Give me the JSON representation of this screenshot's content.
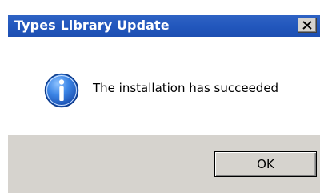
{
  "window": {
    "title": "Types Library Update",
    "close_icon": "close-icon",
    "titlebar_color": "#2257bd"
  },
  "body": {
    "icon": "info-icon",
    "message": "The installation has succeeded"
  },
  "footer": {
    "ok_label": "OK"
  }
}
